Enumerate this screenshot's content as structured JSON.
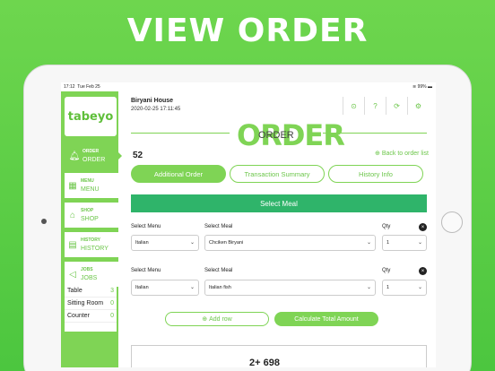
{
  "hero_title": "VIEW ORDER",
  "status_bar": {
    "time": "17:12",
    "date": "Tue Feb 25",
    "battery": "99%"
  },
  "sidebar": {
    "logo": "tabeyo",
    "items": [
      {
        "small": "ORDER",
        "label": "ORDER",
        "icon": "bell-icon",
        "active": true
      },
      {
        "small": "MENU",
        "label": "MENU",
        "icon": "grid-icon",
        "active": false
      },
      {
        "small": "SHOP",
        "label": "SHOP",
        "icon": "shop-icon",
        "active": false
      },
      {
        "small": "HISTORY",
        "label": "HISTORY",
        "icon": "clipboard-icon",
        "active": false
      },
      {
        "small": "JOBS",
        "label": "JOBS",
        "icon": "megaphone-icon",
        "active": false
      }
    ],
    "counts": [
      {
        "label": "Table",
        "value": "3"
      },
      {
        "label": "Sitting Room",
        "value": "0"
      },
      {
        "label": "Counter",
        "value": "0"
      }
    ]
  },
  "header": {
    "restaurant": "Biryani House",
    "datetime": "2020-02-25 17:11:45"
  },
  "top_icons": [
    "download-icon",
    "help-icon",
    "refresh-icon",
    "settings-icon"
  ],
  "title": {
    "big": "ORDER",
    "small": "ORDER"
  },
  "order_number": "52",
  "back_link": "Back to order list",
  "tabs": [
    {
      "label": "Additional Order",
      "active": true
    },
    {
      "label": "Transaction Summary",
      "active": false
    },
    {
      "label": "History Info",
      "active": false
    }
  ],
  "select_meal_button": "Select Meal",
  "rows": [
    {
      "menu_label": "Select Menu",
      "meal_label": "Select Meal",
      "qty_label": "Qty",
      "menu": "Italian",
      "meal": "Chciken Biryani",
      "qty": "1"
    },
    {
      "menu_label": "Select Menu",
      "meal_label": "Select Meal",
      "qty_label": "Qty",
      "menu": "Italian",
      "meal": "Italian fish",
      "qty": "1"
    }
  ],
  "add_row": "Add row",
  "calc_button": "Calculate Total Amount",
  "total_partial": "2+ 698"
}
